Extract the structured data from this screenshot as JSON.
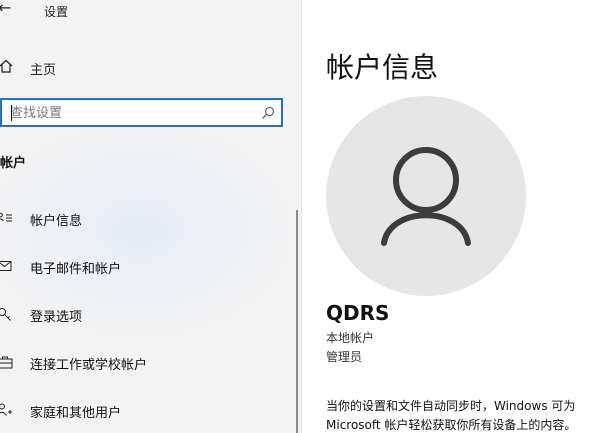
{
  "app": {
    "title": "设置"
  },
  "sidebar": {
    "home_label": "主页",
    "search_placeholder": "查找设置",
    "section_heading": "帐户",
    "items": [
      {
        "label": "帐户信息",
        "icon": "person-card-icon"
      },
      {
        "label": "电子邮件和帐户",
        "icon": "mail-icon"
      },
      {
        "label": "登录选项",
        "icon": "key-icon"
      },
      {
        "label": "连接工作或学校帐户",
        "icon": "briefcase-icon"
      },
      {
        "label": "家庭和其他用户",
        "icon": "person-add-icon"
      }
    ]
  },
  "main": {
    "title": "帐户信息",
    "username": "QDRS",
    "account_type": "本地帐户",
    "account_role": "管理员",
    "description_line1": "当你的设置和文件自动同步时，Windows 可为",
    "description_line2": "Microsoft 帐户轻松获取你所有设备上的内容。"
  },
  "colors": {
    "accent": "#1f72c4",
    "sidebar_bg": "#f2f2f2",
    "avatar_bg": "#e6e6e6"
  }
}
